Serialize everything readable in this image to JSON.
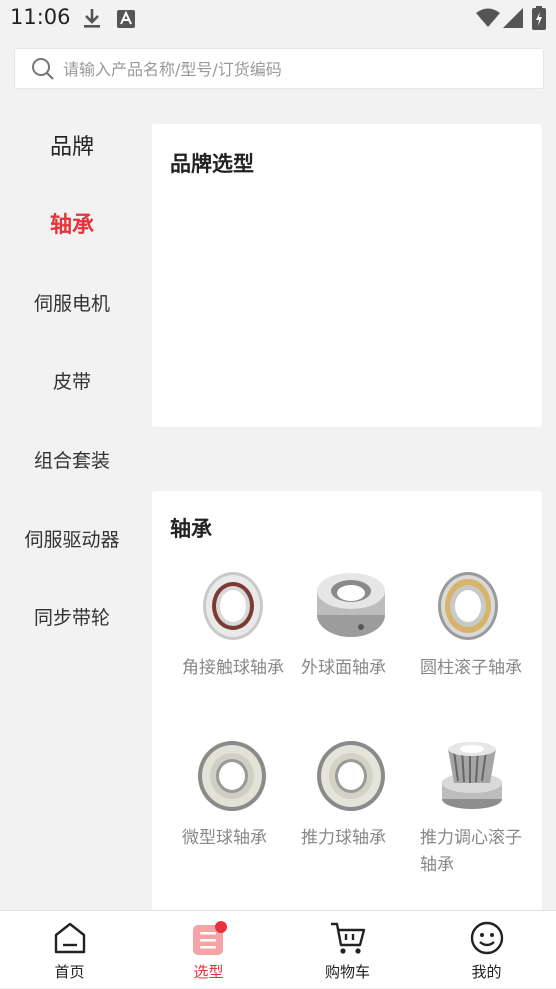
{
  "status_bar": {
    "time": "11:06"
  },
  "search": {
    "placeholder": "请输入产品名称/型号/订货编码",
    "value": ""
  },
  "sidebar": {
    "items": [
      {
        "label": "品牌"
      },
      {
        "label": "轴承"
      },
      {
        "label": "伺服电机"
      },
      {
        "label": "皮带"
      },
      {
        "label": "组合套装"
      },
      {
        "label": "伺服驱动器"
      },
      {
        "label": "同步带轮"
      }
    ],
    "active_index": 1
  },
  "brand_section": {
    "title": "品牌选型"
  },
  "bearing_section": {
    "title": "轴承",
    "products": [
      {
        "name": "角接触球轴承",
        "icon": "angular-contact-bearing-image"
      },
      {
        "name": "外球面轴承",
        "icon": "insert-bearing-image"
      },
      {
        "name": "圆柱滚子轴承",
        "icon": "cylindrical-roller-bearing-image"
      },
      {
        "name": "微型球轴承",
        "icon": "miniature-ball-bearing-image"
      },
      {
        "name": "推力球轴承",
        "icon": "thrust-ball-bearing-image"
      },
      {
        "name": "推力调心滚子轴承",
        "icon": "spherical-thrust-roller-bearing-image"
      }
    ]
  },
  "tabbar": {
    "tabs": [
      {
        "label": "首页",
        "icon": "home-icon"
      },
      {
        "label": "选型",
        "icon": "selection-icon"
      },
      {
        "label": "购物车",
        "icon": "cart-icon"
      },
      {
        "label": "我的",
        "icon": "profile-icon"
      }
    ],
    "active_index": 1
  },
  "colors": {
    "accent": "#e8333a",
    "background": "#f2f2f2",
    "card": "#ffffff"
  }
}
